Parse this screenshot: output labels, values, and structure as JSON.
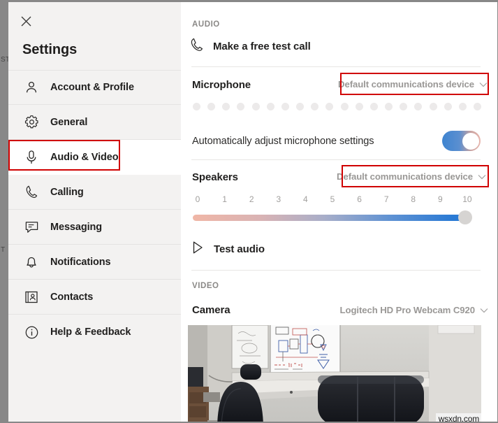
{
  "window": {
    "title": "Settings",
    "close_icon": "close-icon"
  },
  "background_ghost_text": [
    "ST",
    "T"
  ],
  "sidebar": {
    "items": [
      {
        "label": "Account & Profile",
        "icon": "person-icon",
        "selected": false
      },
      {
        "label": "General",
        "icon": "gear-icon",
        "selected": false
      },
      {
        "label": "Audio & Video",
        "icon": "microphone-icon",
        "selected": true
      },
      {
        "label": "Calling",
        "icon": "phone-icon",
        "selected": false
      },
      {
        "label": "Messaging",
        "icon": "chat-bubble-icon",
        "selected": false
      },
      {
        "label": "Notifications",
        "icon": "bell-icon",
        "selected": false
      },
      {
        "label": "Contacts",
        "icon": "contact-card-icon",
        "selected": false
      },
      {
        "label": "Help & Feedback",
        "icon": "info-circle-icon",
        "selected": false
      }
    ]
  },
  "main": {
    "audio_section": {
      "heading": "AUDIO",
      "test_call": {
        "label": "Make a free test call",
        "icon": "phone-icon"
      },
      "microphone": {
        "label": "Microphone",
        "device": "Default communications device",
        "chevron": "chevron-down-icon",
        "level_dots": 20
      },
      "auto_adjust": {
        "label": "Automatically adjust microphone settings",
        "state": "on"
      },
      "speakers": {
        "label": "Speakers",
        "device": "Default communications device",
        "chevron": "chevron-down-icon"
      },
      "volume": {
        "ticks": [
          "0",
          "1",
          "2",
          "3",
          "4",
          "5",
          "6",
          "7",
          "8",
          "9",
          "10"
        ],
        "value": 10,
        "min": 0,
        "max": 10
      },
      "test_audio": {
        "label": "Test audio",
        "icon": "play-icon"
      }
    },
    "video_section": {
      "heading": "VIDEO",
      "camera": {
        "label": "Camera",
        "device": "Logitech HD Pro Webcam C920",
        "chevron": "chevron-down-icon"
      },
      "preview_alt": "office room with whiteboard and two black office chairs"
    }
  },
  "annotations": {
    "color": "#d00000",
    "boxes": [
      {
        "target": "sidebar-item-audio-video"
      },
      {
        "target": "microphone-device-dropdown"
      },
      {
        "target": "speakers-device-dropdown"
      }
    ]
  },
  "watermark": "wsxdn.com"
}
